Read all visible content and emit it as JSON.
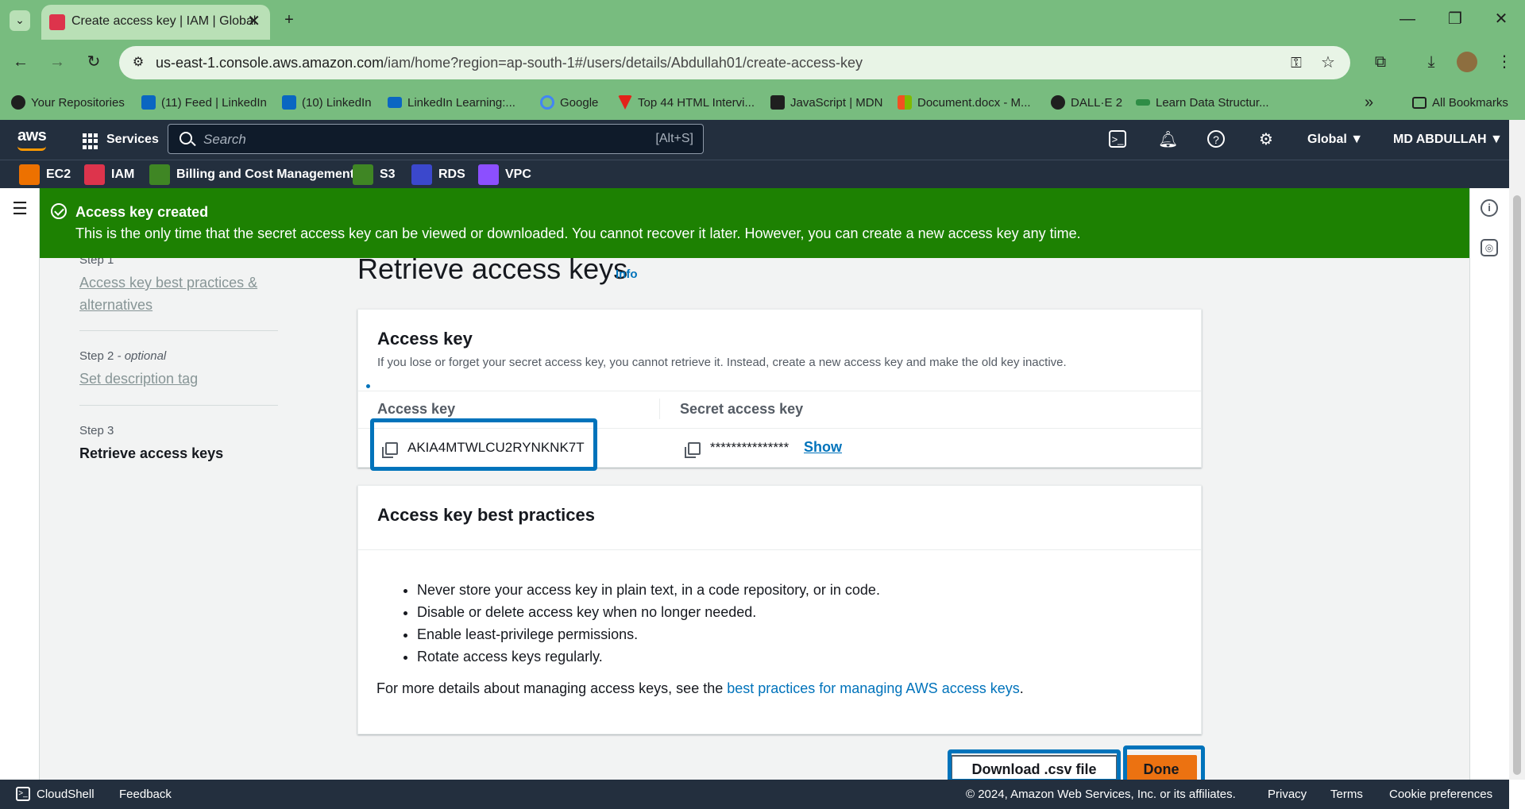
{
  "browser": {
    "tab_title": "Create access key | IAM | Global",
    "url_host": "us-east-1.console.aws.amazon.com",
    "url_path": "/iam/home?region=ap-south-1#/users/details/Abdullah01/create-access-key",
    "bookmarks": [
      {
        "label": "Your Repositories"
      },
      {
        "label": "(11) Feed | LinkedIn"
      },
      {
        "label": "(10) LinkedIn"
      },
      {
        "label": "LinkedIn Learning:..."
      },
      {
        "label": "Google"
      },
      {
        "label": "Top 44 HTML Intervi..."
      },
      {
        "label": "JavaScript | MDN"
      },
      {
        "label": "Document.docx - M..."
      },
      {
        "label": "DALL·E 2"
      },
      {
        "label": "Learn Data Structur..."
      }
    ],
    "all_bookmarks": "All Bookmarks"
  },
  "aws_header": {
    "logo": "aws",
    "services": "Services",
    "search_placeholder": "Search",
    "search_shortcut": "[Alt+S]",
    "region": "Global ▼",
    "user": "MD ABDULLAH ▼",
    "favorites": [
      {
        "label": "EC2",
        "color": "#ed7100"
      },
      {
        "label": "IAM",
        "color": "#dd344c"
      },
      {
        "label": "Billing and Cost Management",
        "color": "#3f8624"
      },
      {
        "label": "S3",
        "color": "#3f8624"
      },
      {
        "label": "RDS",
        "color": "#3b48cc"
      },
      {
        "label": "VPC",
        "color": "#8c4fff"
      }
    ]
  },
  "flash": {
    "title": "Access key created",
    "message": "This is the only time that the secret access key can be viewed or downloaded. You cannot recover it later. However, you can create a new access key any time."
  },
  "steps": [
    {
      "label": "Step 1",
      "title": "Access key best practices & alternatives"
    },
    {
      "label": "Step 2",
      "optional": "- optional",
      "title": "Set description tag"
    },
    {
      "label": "Step 3",
      "title": "Retrieve access keys"
    }
  ],
  "page": {
    "title": "Retrieve access keys",
    "info": "Info"
  },
  "access_key_panel": {
    "heading": "Access key",
    "description": "If you lose or forget your secret access key, you cannot retrieve it. Instead, create a new access key and make the old key inactive.",
    "col_access_key": "Access key",
    "col_secret_key": "Secret access key",
    "access_key_value": "AKIA4MTWLCU2RYNKNK7T",
    "secret_masked": "***************",
    "show": "Show"
  },
  "best_practices_panel": {
    "heading": "Access key best practices",
    "items": [
      "Never store your access key in plain text, in a code repository, or in code.",
      "Disable or delete access key when no longer needed.",
      "Enable least-privilege permissions.",
      "Rotate access keys regularly."
    ],
    "note_prefix": "For more details about managing access keys, see the ",
    "note_link": "best practices for managing AWS access keys",
    "note_suffix": "."
  },
  "actions": {
    "download": "Download .csv file",
    "done": "Done"
  },
  "footer": {
    "cloudshell": "CloudShell",
    "feedback": "Feedback",
    "copyright": "© 2024, Amazon Web Services, Inc. or its affiliates.",
    "privacy": "Privacy",
    "terms": "Terms",
    "cookies": "Cookie preferences"
  },
  "colors": {
    "browser_frame": "#78bc7f",
    "aws_navy": "#232f3e",
    "success_green": "#1d8102",
    "link_blue": "#0073bb",
    "primary_orange": "#ec7211"
  }
}
